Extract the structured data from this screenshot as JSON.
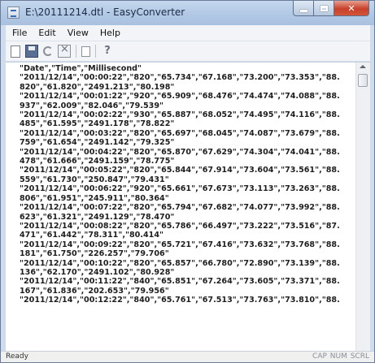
{
  "window": {
    "title": "E:\\20111214.dtl - EasyConverter"
  },
  "menu": [
    "File",
    "Edit",
    "View",
    "Help"
  ],
  "toolbar": {
    "icons": [
      "new-file-icon",
      "save-icon",
      "undo-icon",
      "close-file-icon",
      "copy-icon",
      "help-icon"
    ]
  },
  "content": {
    "lines": [
      "\"Date\",\"Time\",\"Millisecond\"",
      "\"2011/12/14\",\"00:00:22\",\"820\",\"65.734\",\"67.168\",\"73.200\",\"73.353\",\"88.",
      "820\",\"61.820\",\"2491.213\",\"80.198\"",
      "\"2011/12/14\",\"00:01:22\",\"920\",\"65.909\",\"68.476\",\"74.474\",\"74.088\",\"88.",
      "937\",\"62.009\",\"82.046\",\"79.539\"",
      "\"2011/12/14\",\"00:02:22\",\"930\",\"65.887\",\"68.052\",\"74.495\",\"74.116\",\"88.",
      "485\",\"61.595\",\"2491.178\",\"78.822\"",
      "\"2011/12/14\",\"00:03:22\",\"820\",\"65.697\",\"68.045\",\"74.087\",\"73.679\",\"88.",
      "759\",\"61.654\",\"2491.142\",\"79.325\"",
      "\"2011/12/14\",\"00:04:22\",\"820\",\"65.870\",\"67.629\",\"74.304\",\"74.041\",\"88.",
      "478\",\"61.666\",\"2491.159\",\"78.775\"",
      "\"2011/12/14\",\"00:05:22\",\"820\",\"65.844\",\"67.914\",\"73.604\",\"73.561\",\"88.",
      "559\",\"61.730\",\"250.847\",\"79.431\"",
      "\"2011/12/14\",\"00:06:22\",\"920\",\"65.661\",\"67.673\",\"73.113\",\"73.263\",\"88.",
      "806\",\"61.951\",\"245.911\",\"80.364\"",
      "\"2011/12/14\",\"00:07:22\",\"820\",\"65.794\",\"67.682\",\"74.077\",\"73.992\",\"88.",
      "623\",\"61.321\",\"2491.129\",\"78.470\"",
      "\"2011/12/14\",\"00:08:22\",\"820\",\"65.786\",\"66.497\",\"73.222\",\"73.516\",\"87.",
      "471\",\"61.442\",\"78.311\",\"80.414\"",
      "\"2011/12/14\",\"00:09:22\",\"820\",\"65.721\",\"67.416\",\"73.632\",\"73.768\",\"88.",
      "181\",\"61.750\",\"226.257\",\"79.706\"",
      "\"2011/12/14\",\"00:10:22\",\"820\",\"65.857\",\"66.780\",\"72.890\",\"73.139\",\"88.",
      "136\",\"62.170\",\"2491.102\",\"80.928\"",
      "\"2011/12/14\",\"00:11:22\",\"840\",\"65.851\",\"67.264\",\"73.605\",\"73.371\",\"88.",
      "167\",\"61.836\",\"202.653\",\"79.956\"",
      "\"2011/12/14\",\"00:12:22\",\"840\",\"65.761\",\"67.513\",\"73.763\",\"73.810\",\"88."
    ]
  },
  "status": {
    "left": "Ready",
    "right": "CAP NUM SCRL"
  }
}
